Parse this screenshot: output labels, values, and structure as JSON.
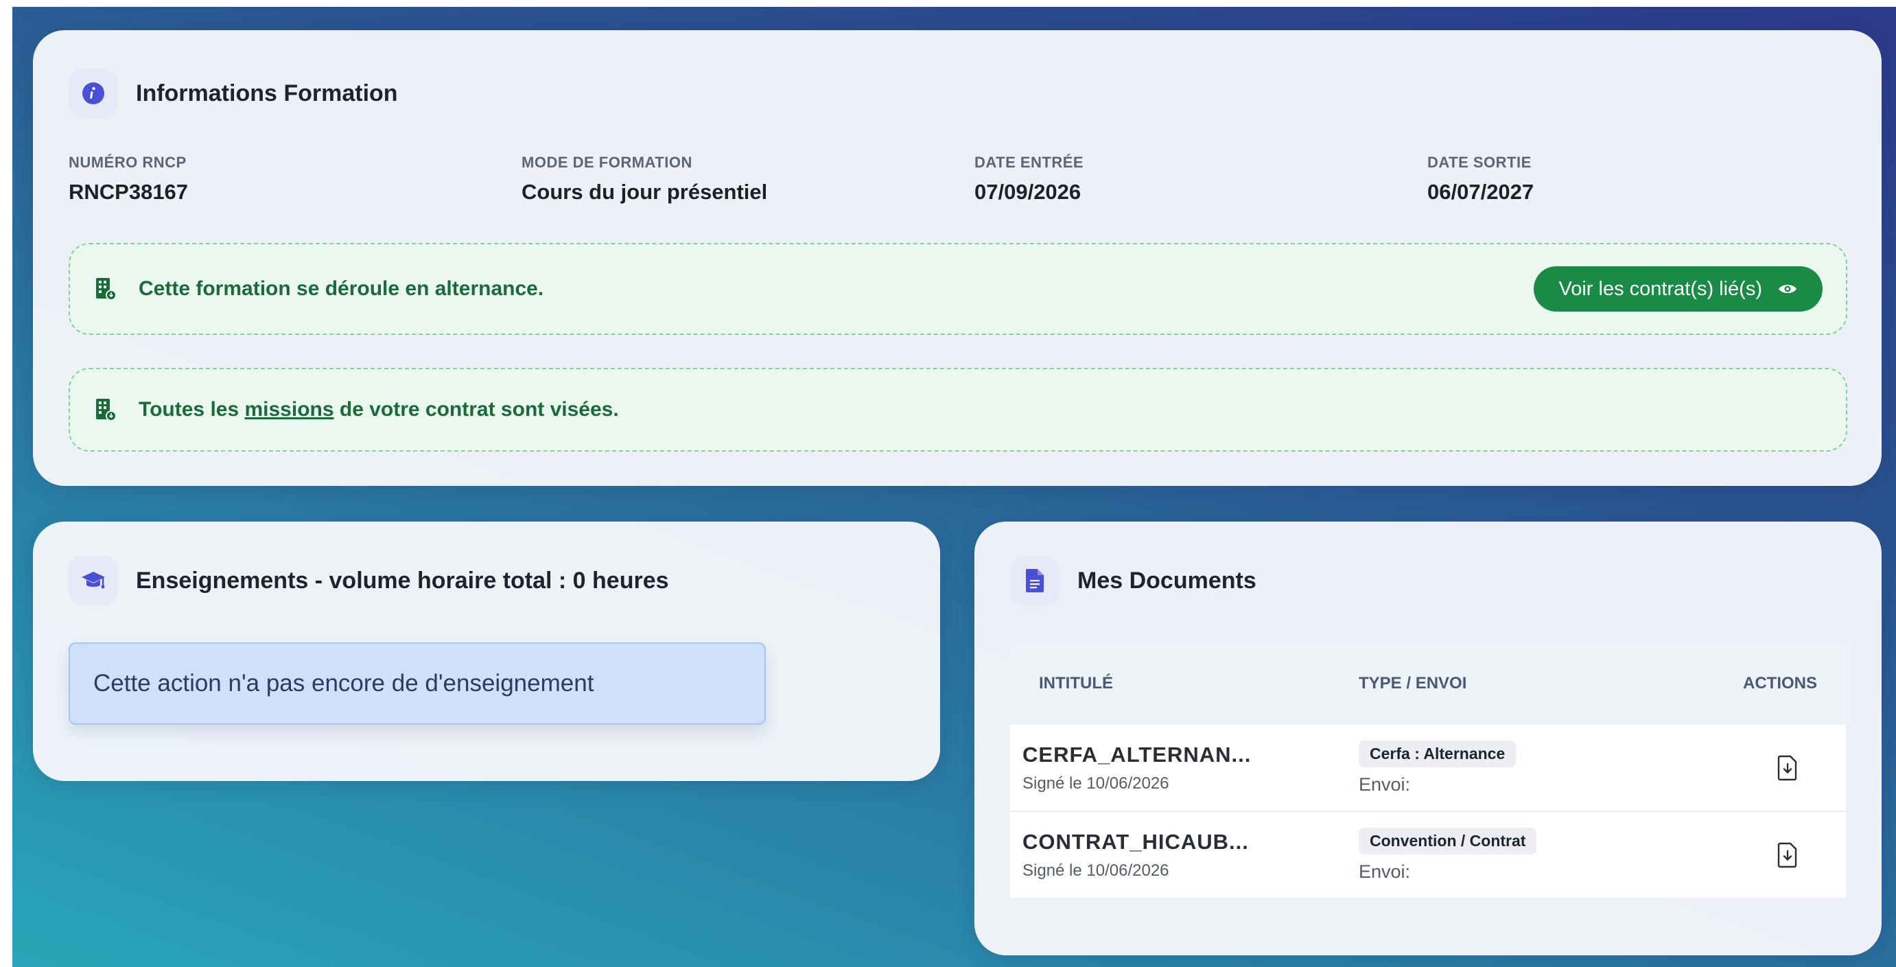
{
  "formation": {
    "title": "Informations Formation",
    "fields": [
      {
        "label": "NUMÉRO RNCP",
        "value": "RNCP38167"
      },
      {
        "label": "MODE DE FORMATION",
        "value": "Cours du jour présentiel"
      },
      {
        "label": "DATE ENTRÉE",
        "value": "07/09/2026"
      },
      {
        "label": "DATE SORTIE",
        "value": "06/07/2027"
      }
    ],
    "alternance_notice": "Cette formation se déroule en alternance.",
    "contract_button": "Voir les contrat(s) lié(s)",
    "missions_notice": {
      "before": "Toutes les ",
      "link": "missions",
      "after": " de votre contrat sont visées."
    }
  },
  "enseignements": {
    "title": "Enseignements - volume horaire total : 0 heures",
    "empty_message": "Cette action n'a pas encore de d'enseignement"
  },
  "documents": {
    "title": "Mes Documents",
    "headers": {
      "name": "INTITULÉ",
      "type": "TYPE / ENVOI",
      "actions": "ACTIONS"
    },
    "rows": [
      {
        "name": "CERFA_ALTERNAN...",
        "signed": "Signé le 10/06/2026",
        "type": "Cerfa : Alternance",
        "send": "Envoi:"
      },
      {
        "name": "CONTRAT_HICAUB...",
        "signed": "Signé le 10/06/2026",
        "type": "Convention / Contrat",
        "send": "Envoi:"
      }
    ]
  },
  "colors": {
    "accent": "#4a4fd8",
    "success": "#1a8a47",
    "success_bg": "#eaf8ef",
    "info_bg": "#cfe0fb"
  },
  "icons": {
    "formation": "info-icon",
    "notice": "building-icon",
    "contract_button": "eye-icon",
    "enseignements": "graduation-cap-icon",
    "documents": "document-icon",
    "row_action": "download-icon"
  }
}
